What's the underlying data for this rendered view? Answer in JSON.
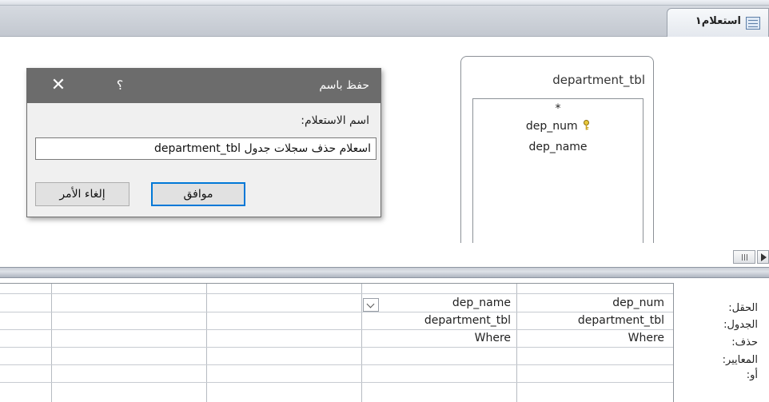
{
  "tab": {
    "label": "استعلام١",
    "icon": "query-icon"
  },
  "table_box": {
    "title": "department_tbl",
    "star": "*",
    "fields": [
      "dep_num",
      "dep_name"
    ],
    "primary_key_icon": "key-icon"
  },
  "grid": {
    "row_labels": [
      "الحقل:",
      "الجدول:",
      "حذف:",
      "المعايير:",
      "أو:"
    ],
    "columns": [
      {
        "field": "dep_num",
        "table": "department_tbl",
        "delete": "Where"
      },
      {
        "field": "dep_name",
        "table": "department_tbl",
        "delete": "Where"
      },
      {
        "field": "",
        "table": "",
        "delete": ""
      },
      {
        "field": "",
        "table": "",
        "delete": ""
      },
      {
        "field": "",
        "table": "",
        "delete": ""
      }
    ]
  },
  "dialog": {
    "title": "حفظ باسم",
    "help": "؟",
    "close": "✕",
    "label": "اسم الاستعلام:",
    "value": "اسعلام حذف سجلات جدول department_tbl",
    "ok": "موافق",
    "cancel": "إلغاء الأمر"
  },
  "colors": {
    "dialog_titlebar": "#6c6c6c",
    "focus_border": "#0078d7",
    "tabbar": "#c3c8d0"
  }
}
